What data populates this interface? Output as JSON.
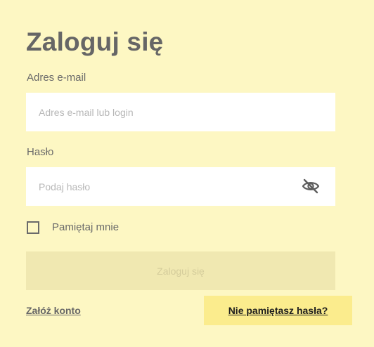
{
  "login_form": {
    "title": "Zaloguj się",
    "email": {
      "label": "Adres e-mail",
      "placeholder": "Adres e-mail lub login",
      "value": ""
    },
    "password": {
      "label": "Hasło",
      "placeholder": "Podaj hasło",
      "value": "",
      "visibility_icon": "eye-slash-icon"
    },
    "remember": {
      "label": "Pamiętaj mnie",
      "checked": false
    },
    "submit_label": "Zaloguj się",
    "create_account_label": "Załóż konto",
    "forgot_password_label": "Nie pamiętasz hasła?"
  },
  "colors": {
    "background": "#fdf7c3",
    "input_background": "#ffffff",
    "button_disabled_background": "#f0e8b1",
    "button_disabled_text": "#d4cc9b",
    "forgot_highlight": "#fbec8d",
    "text_primary": "#666666"
  }
}
